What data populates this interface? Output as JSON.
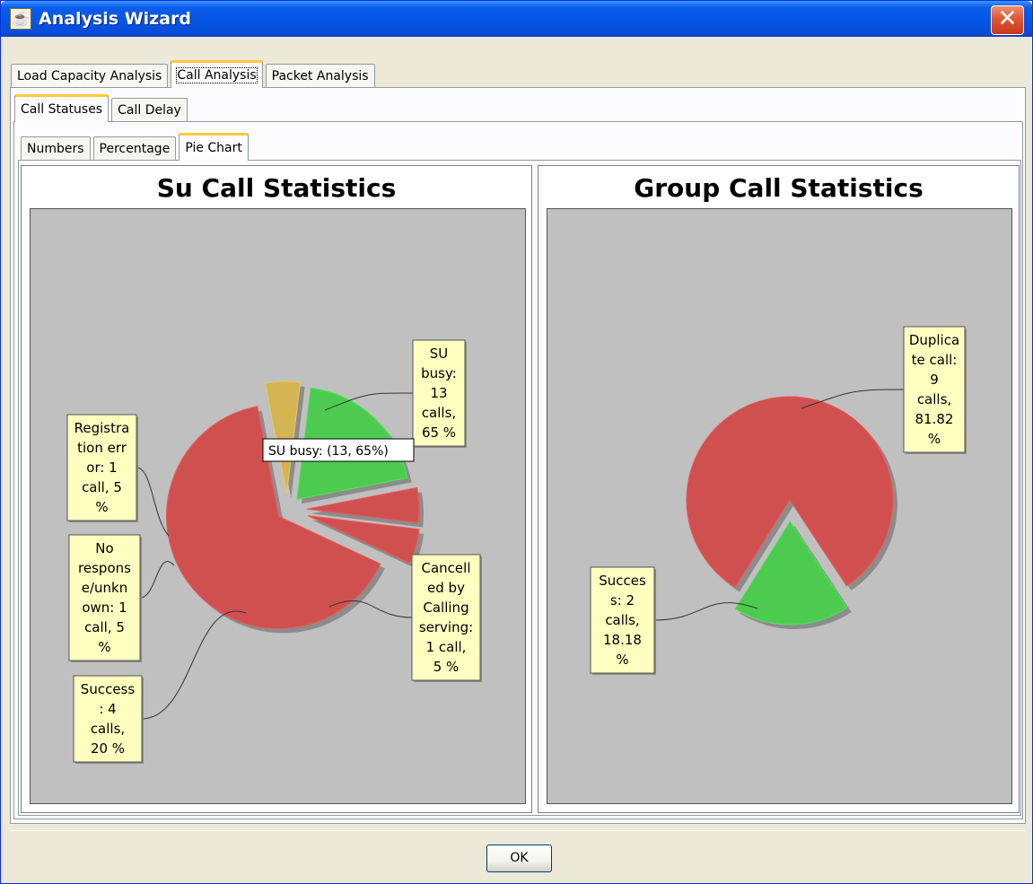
{
  "window": {
    "title": "Analysis Wizard",
    "icon": "java-cup-icon",
    "close_icon": "close-icon"
  },
  "tabs_top": [
    {
      "label": "Load Capacity Analysis",
      "active": false
    },
    {
      "label": "Call Analysis",
      "active": true
    },
    {
      "label": "Packet Analysis",
      "active": false
    }
  ],
  "tabs_mid": [
    {
      "label": "Call Statuses",
      "active": true
    },
    {
      "label": "Call Delay",
      "active": false
    }
  ],
  "tabs_low": [
    {
      "label": "Numbers",
      "active": false
    },
    {
      "label": "Percentage",
      "active": false
    },
    {
      "label": "Pie Chart",
      "active": true
    }
  ],
  "buttons": {
    "ok": "OK"
  },
  "tooltip": "SU busy: (13, 65%)",
  "colors": {
    "red": "#D05050",
    "green": "#4CCB50",
    "gold": "#D4B453",
    "label_bg": "#FFFFC0",
    "plot_bg": "#C0C0C0"
  },
  "chart_data": [
    {
      "type": "pie",
      "title": "Su Call Statistics",
      "slices": [
        {
          "name": "SU busy",
          "value": 13,
          "percent": 65,
          "color": "red",
          "label_lines": [
            "SU",
            "busy:",
            "13",
            "calls,",
            "65 %"
          ]
        },
        {
          "name": "Cancelled by Calling serving",
          "value": 1,
          "percent": 5,
          "color": "gold",
          "label_lines": [
            "Cancell",
            "ed by",
            "Calling",
            "serving:",
            "1 call,",
            "5 %"
          ]
        },
        {
          "name": "Success",
          "value": 4,
          "percent": 20,
          "color": "green",
          "label_lines": [
            "Success",
            ": 4",
            "calls,",
            "20 %"
          ]
        },
        {
          "name": "No response/unknown",
          "value": 1,
          "percent": 5,
          "color": "red",
          "label_lines": [
            "No",
            "respons",
            "e/unkn",
            "own: 1",
            "call, 5",
            "%"
          ]
        },
        {
          "name": "Registration error",
          "value": 1,
          "percent": 5,
          "color": "red",
          "label_lines": [
            "Registra",
            "tion err",
            "or: 1",
            "call, 5",
            "%"
          ]
        }
      ]
    },
    {
      "type": "pie",
      "title": "Group Call Statistics",
      "slices": [
        {
          "name": "Duplicate call",
          "value": 9,
          "percent": 81.82,
          "color": "red",
          "label_lines": [
            "Duplica",
            "te call:",
            "9",
            "calls,",
            "81.82",
            "%"
          ]
        },
        {
          "name": "Success",
          "value": 2,
          "percent": 18.18,
          "color": "green",
          "label_lines": [
            "Succes",
            "s: 2",
            "calls,",
            "18.18",
            "%"
          ]
        }
      ]
    }
  ]
}
